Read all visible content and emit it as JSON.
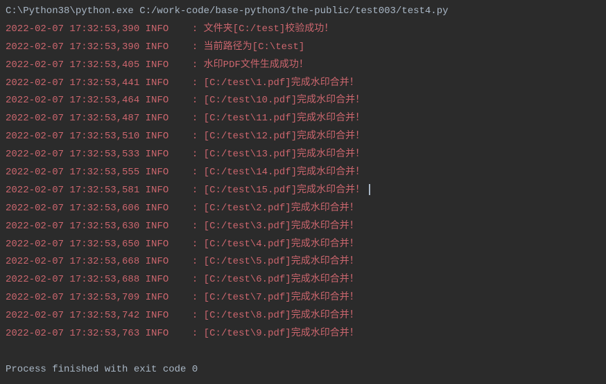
{
  "command": "C:\\Python38\\python.exe C:/work-code/base-python3/the-public/test003/test4.py",
  "logs": [
    {
      "timestamp": "2022-02-07 17:32:53,390",
      "level": "INFO",
      "message": "文件夹[C:/test]校验成功！"
    },
    {
      "timestamp": "2022-02-07 17:32:53,390",
      "level": "INFO",
      "message": "当前路径为[C:\\test]"
    },
    {
      "timestamp": "2022-02-07 17:32:53,405",
      "level": "INFO",
      "message": "水印PDF文件生成成功！"
    },
    {
      "timestamp": "2022-02-07 17:32:53,441",
      "level": "INFO",
      "message": "[C:/test\\1.pdf]完成水印合并！"
    },
    {
      "timestamp": "2022-02-07 17:32:53,464",
      "level": "INFO",
      "message": "[C:/test\\10.pdf]完成水印合并！"
    },
    {
      "timestamp": "2022-02-07 17:32:53,487",
      "level": "INFO",
      "message": "[C:/test\\11.pdf]完成水印合并！"
    },
    {
      "timestamp": "2022-02-07 17:32:53,510",
      "level": "INFO",
      "message": "[C:/test\\12.pdf]完成水印合并！"
    },
    {
      "timestamp": "2022-02-07 17:32:53,533",
      "level": "INFO",
      "message": "[C:/test\\13.pdf]完成水印合并！"
    },
    {
      "timestamp": "2022-02-07 17:32:53,555",
      "level": "INFO",
      "message": "[C:/test\\14.pdf]完成水印合并！"
    },
    {
      "timestamp": "2022-02-07 17:32:53,581",
      "level": "INFO",
      "message": "[C:/test\\15.pdf]完成水印合并！",
      "cursor": true
    },
    {
      "timestamp": "2022-02-07 17:32:53,606",
      "level": "INFO",
      "message": "[C:/test\\2.pdf]完成水印合并！"
    },
    {
      "timestamp": "2022-02-07 17:32:53,630",
      "level": "INFO",
      "message": "[C:/test\\3.pdf]完成水印合并！"
    },
    {
      "timestamp": "2022-02-07 17:32:53,650",
      "level": "INFO",
      "message": "[C:/test\\4.pdf]完成水印合并！"
    },
    {
      "timestamp": "2022-02-07 17:32:53,668",
      "level": "INFO",
      "message": "[C:/test\\5.pdf]完成水印合并！"
    },
    {
      "timestamp": "2022-02-07 17:32:53,688",
      "level": "INFO",
      "message": "[C:/test\\6.pdf]完成水印合并！"
    },
    {
      "timestamp": "2022-02-07 17:32:53,709",
      "level": "INFO",
      "message": "[C:/test\\7.pdf]完成水印合并！"
    },
    {
      "timestamp": "2022-02-07 17:32:53,742",
      "level": "INFO",
      "message": "[C:/test\\8.pdf]完成水印合并！"
    },
    {
      "timestamp": "2022-02-07 17:32:53,763",
      "level": "INFO",
      "message": "[C:/test\\9.pdf]完成水印合并！"
    }
  ],
  "exit_message": "Process finished with exit code 0"
}
